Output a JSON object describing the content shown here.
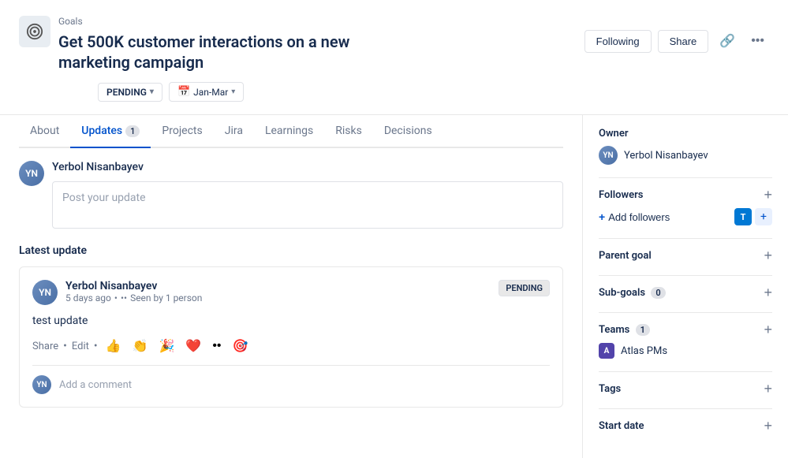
{
  "header": {
    "breadcrumb": "Goals",
    "title": "Get 500K customer interactions on a new marketing campaign",
    "status": "PENDING",
    "quarter": "Jan-Mar",
    "actions": {
      "following": "Following",
      "share": "Share"
    }
  },
  "tabs": [
    {
      "label": "About",
      "active": false,
      "count": null
    },
    {
      "label": "Updates",
      "active": true,
      "count": "1"
    },
    {
      "label": "Projects",
      "active": false,
      "count": null
    },
    {
      "label": "Jira",
      "active": false,
      "count": null
    },
    {
      "label": "Learnings",
      "active": false,
      "count": null
    },
    {
      "label": "Risks",
      "active": false,
      "count": null
    },
    {
      "label": "Decisions",
      "active": false,
      "count": null
    }
  ],
  "update_input": {
    "user_initials": "YN",
    "user_name": "Yerbol Nisanbayev",
    "placeholder": "Post your update"
  },
  "latest_update": {
    "section_title": "Latest update",
    "author": "Yerbol Nisanbayev",
    "author_initials": "YN",
    "time": "5 days ago",
    "seen": "Seen by 1 person",
    "status": "PENDING",
    "text": "test update",
    "actions": {
      "share": "Share",
      "edit": "Edit"
    },
    "emojis": [
      "👍",
      "👏",
      "🎉",
      "❤️",
      "··",
      "🎯"
    ],
    "comment_placeholder": "Add a comment",
    "comment_user_initials": "YN"
  },
  "right_panel": {
    "owner": {
      "title": "Owner",
      "name": "Yerbol Nisanbayev",
      "initials": "YN"
    },
    "followers": {
      "title": "Followers",
      "add_label": "Add followers"
    },
    "parent_goal": {
      "title": "Parent goal"
    },
    "sub_goals": {
      "title": "Sub-goals",
      "count": "0"
    },
    "teams": {
      "title": "Teams",
      "count": "1",
      "items": [
        {
          "name": "Atlas PMs",
          "initial": "A"
        }
      ]
    },
    "tags": {
      "title": "Tags"
    },
    "start_date": {
      "title": "Start date"
    }
  }
}
